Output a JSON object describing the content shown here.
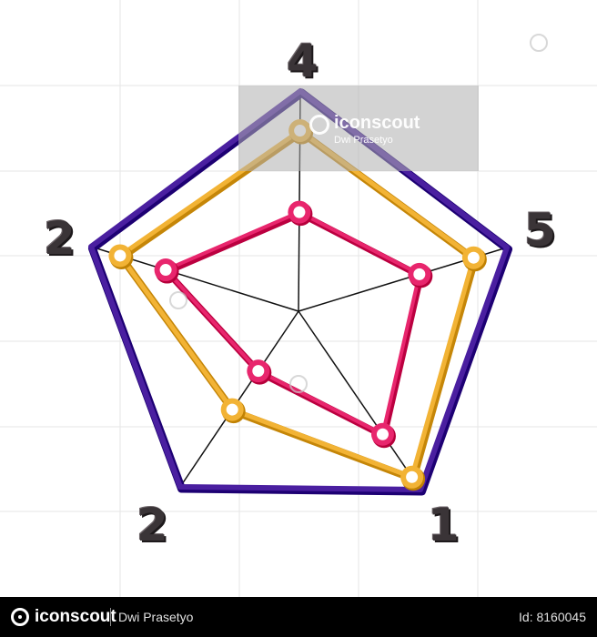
{
  "illustration": {
    "axis_labels": [
      "4",
      "5",
      "1",
      "2",
      "2"
    ],
    "axis_count": 5,
    "colors": {
      "outer": "#4a1fa0",
      "middle": "#f2b335",
      "inner": "#e8266d",
      "spokes": "#111111",
      "grid": "#e6e6e6",
      "label": "#3a3437"
    },
    "levels": {
      "outer": [
        1,
        1,
        1,
        1,
        1
      ],
      "middle": [
        0.82,
        0.84,
        0.93,
        0.56,
        0.86
      ],
      "inner": [
        0.45,
        0.58,
        0.69,
        0.34,
        0.64
      ]
    }
  },
  "watermark": {
    "brand": "iconscout",
    "author": "Dwi Prasetyo"
  },
  "footer": {
    "brand": "iconscout",
    "author": "Dwi Prasetyo",
    "id_text": "Id: 8160045"
  }
}
